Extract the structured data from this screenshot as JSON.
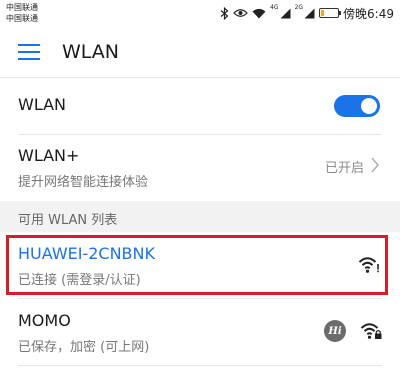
{
  "status_bar": {
    "carrier_1": "中国联通",
    "carrier_2": "中国联通",
    "network_tag_1": "4G",
    "network_tag_2": "2G",
    "battery_level": 0.2,
    "battery_color": "#f5a623",
    "time": "傍晚6:49",
    "icons": [
      "bluetooth-icon",
      "eye-icon",
      "wifi-icon",
      "signal-icon",
      "signal-icon",
      "battery-icon"
    ]
  },
  "app_bar": {
    "title": "WLAN",
    "menu_icon": "hamburger-menu-icon"
  },
  "settings": {
    "wlan": {
      "label": "WLAN",
      "enabled": true
    },
    "wlan_plus": {
      "label": "WLAN+",
      "subtitle": "提升网络智能连接体验",
      "value": "已开启"
    }
  },
  "section": {
    "label": "可用 WLAN 列表"
  },
  "networks": [
    {
      "name": "HUAWEI-2CNBNK",
      "status": "已连接 (需登录/认证)",
      "connected": true,
      "icon": "wifi-warning-icon"
    },
    {
      "name": "MOMO",
      "status": "已保存，加密 (可上网)",
      "connected": false,
      "badge": "Hi",
      "icon": "wifi-locked-icon"
    }
  ],
  "colors": {
    "accent": "#1a73e8",
    "highlight_border": "#d41f26",
    "section_background": "#f2f2f2"
  }
}
